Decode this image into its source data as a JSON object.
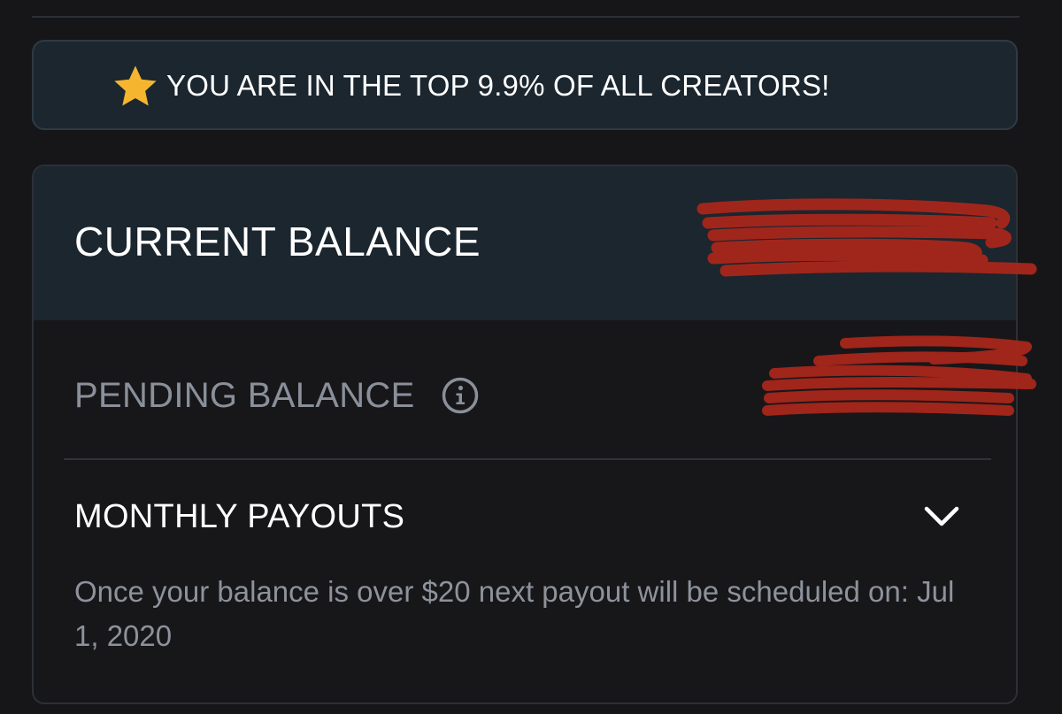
{
  "banner": {
    "icon": "star-icon",
    "icon_color": "#f6b52f",
    "text": "YOU ARE IN THE TOP 9.9% OF ALL CREATORS!"
  },
  "balance_card": {
    "current_balance_label": "CURRENT BALANCE",
    "pending_balance_label": "PENDING BALANCE",
    "pending_info_icon": "info-icon",
    "monthly_payouts_label": "MONTHLY PAYOUTS",
    "monthly_payouts_toggle_icon": "chevron-down-icon",
    "payout_note": "Once your balance is over $20 next payout will be scheduled on: Jul 1, 2020"
  },
  "colors": {
    "background": "#161618",
    "banner_background": "#1b262f",
    "redaction_mark": "#a8261b"
  }
}
